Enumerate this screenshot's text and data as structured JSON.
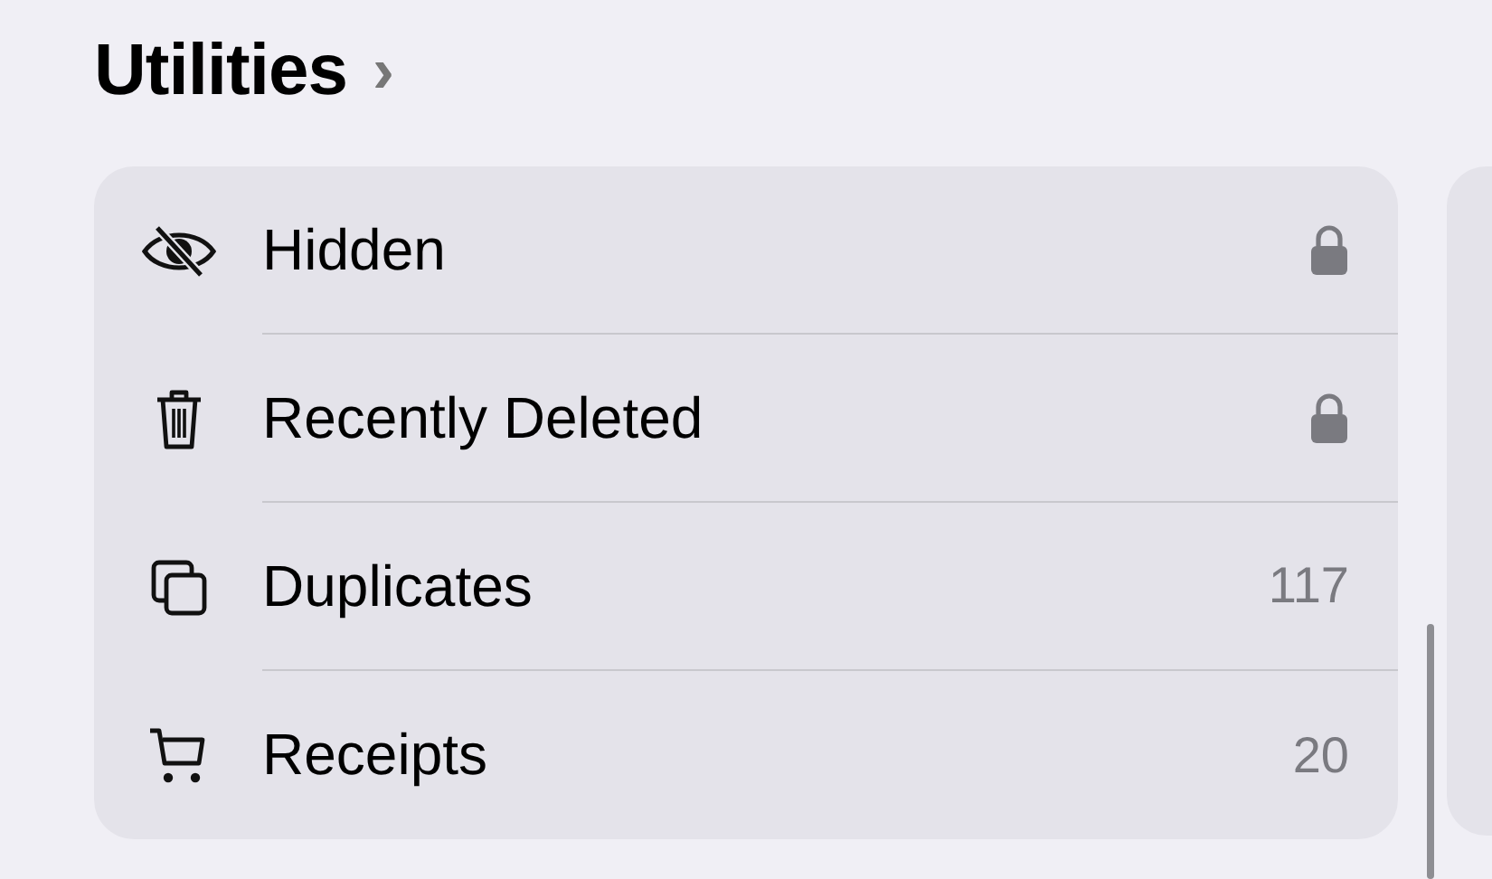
{
  "section": {
    "title": "Utilities",
    "chevron": "›"
  },
  "rows": [
    {
      "label": "Hidden",
      "locked": true
    },
    {
      "label": "Recently Deleted",
      "locked": true
    },
    {
      "label": "Duplicates",
      "locked": false,
      "count": "117"
    },
    {
      "label": "Receipts",
      "locked": false,
      "count": "20"
    }
  ]
}
